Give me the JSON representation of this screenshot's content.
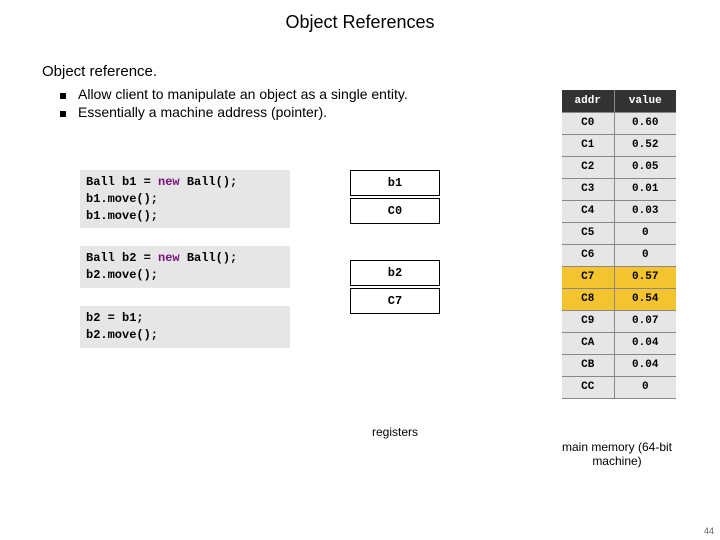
{
  "title": "Object References",
  "heading": "Object reference.",
  "bullets": [
    "Allow client to manipulate an object as a single entity.",
    "Essentially a machine address (pointer)."
  ],
  "code": {
    "block1": {
      "l1a": "Ball b1 = ",
      "l1kw": "new",
      "l1b": " Ball();",
      "l2": "b1.move();",
      "l3": "b1.move();"
    },
    "block2": {
      "l1a": "Ball b2 = ",
      "l1kw": "new",
      "l1b": " Ball();",
      "l2": "b2.move();"
    },
    "block3": {
      "l1": "b2 = b1;",
      "l2": "b2.move();"
    }
  },
  "registers": [
    {
      "label": "b1",
      "gap": false
    },
    {
      "label": "C0",
      "gap": false
    },
    {
      "label": "b2",
      "gap": true
    },
    {
      "label": "C7",
      "gap": false
    }
  ],
  "registers_caption": "registers",
  "memory": {
    "headers": [
      "addr",
      "value"
    ],
    "rows": [
      {
        "addr": "C0",
        "value": "0.60",
        "hl": false
      },
      {
        "addr": "C1",
        "value": "0.52",
        "hl": false
      },
      {
        "addr": "C2",
        "value": "0.05",
        "hl": false
      },
      {
        "addr": "C3",
        "value": "0.01",
        "hl": false
      },
      {
        "addr": "C4",
        "value": "0.03",
        "hl": false
      },
      {
        "addr": "C5",
        "value": "0",
        "hl": false
      },
      {
        "addr": "C6",
        "value": "0",
        "hl": false
      },
      {
        "addr": "C7",
        "value": "0.57",
        "hl": true
      },
      {
        "addr": "C8",
        "value": "0.54",
        "hl": true
      },
      {
        "addr": "C9",
        "value": "0.07",
        "hl": false
      },
      {
        "addr": "CA",
        "value": "0.04",
        "hl": false
      },
      {
        "addr": "CB",
        "value": "0.04",
        "hl": false
      },
      {
        "addr": "CC",
        "value": "0",
        "hl": false
      }
    ],
    "caption": "main memory\n(64-bit machine)"
  },
  "page_number": "44"
}
